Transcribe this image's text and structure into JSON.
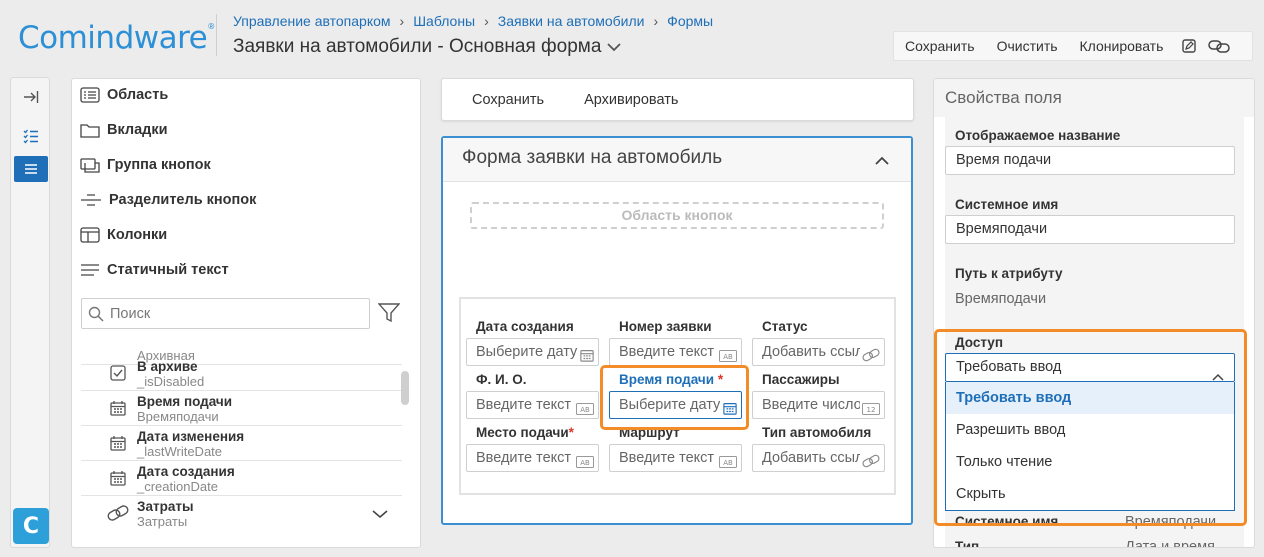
{
  "header": {
    "logo": "Comindware",
    "logo_mark": "®",
    "breadcrumbs": [
      "Управление автопарком",
      "Шаблоны",
      "Заявки на автомобили",
      "Формы"
    ],
    "breadcrumb_sep": "›",
    "title": "Заявки на автомобили - Основная форма",
    "toolbar": {
      "save": "Сохранить",
      "clear": "Очистить",
      "clone": "Клонировать"
    }
  },
  "rail": {
    "logo_letter": "C"
  },
  "components": {
    "items": [
      "Область",
      "Вкладки",
      "Группа кнопок",
      "Разделитель кнопок",
      "Колонки",
      "Статичный текст"
    ],
    "search_placeholder": "Поиск",
    "partial_row": "Архивная",
    "attributes": [
      {
        "name": "В архиве",
        "sys": "_isDisabled",
        "icon": "checkbox-icon"
      },
      {
        "name": "Время подачи",
        "sys": "Времяподачи",
        "icon": "calendar-icon"
      },
      {
        "name": "Дата изменения",
        "sys": "_lastWriteDate",
        "icon": "calendar-icon"
      },
      {
        "name": "Дата создания",
        "sys": "_creationDate",
        "icon": "calendar-icon"
      },
      {
        "name": "Затраты",
        "sys": "Затраты",
        "icon": "link-icon"
      }
    ]
  },
  "form": {
    "toolbar": {
      "save": "Сохранить",
      "archive": "Архивировать"
    },
    "title": "Форма заявки на автомобиль",
    "button_area": "Область кнопок",
    "fields": [
      {
        "label": "Дата создания",
        "placeholder": "Выберите дату",
        "icon": "calendar-icon",
        "required": false
      },
      {
        "label": "Номер заявки",
        "placeholder": "Введите текст",
        "icon": "text-icon",
        "required": false
      },
      {
        "label": "Статус",
        "placeholder": "Добавить ссылку",
        "icon": "link-icon",
        "required": false
      },
      {
        "label": "Ф. И. О.",
        "placeholder": "Введите текст",
        "icon": "text-icon",
        "required": false
      },
      {
        "label": "Время подачи",
        "placeholder": "Выберите дату",
        "icon": "calendar-icon",
        "required": true,
        "selected": true
      },
      {
        "label": "Пассажиры",
        "placeholder": "Введите число",
        "icon": "number-icon",
        "required": false
      },
      {
        "label": "Место подачи",
        "placeholder": "Введите текст",
        "icon": "text-icon",
        "required": true
      },
      {
        "label": "Маршрут",
        "placeholder": "Введите текст",
        "icon": "text-icon",
        "required": false
      },
      {
        "label": "Тип автомобиля",
        "placeholder": "Добавить ссылку",
        "icon": "link-icon",
        "required": false
      }
    ],
    "required_mark": "*"
  },
  "properties": {
    "title": "Свойства поля",
    "display_name_label": "Отображаемое название",
    "display_name_value": "Время подачи",
    "system_name_label": "Системное имя",
    "system_name_value": "Времяподачи",
    "path_label": "Путь к атрибуту",
    "path_value": "Времяподачи",
    "access_label": "Доступ",
    "access_value": "Требовать ввод",
    "access_options": [
      "Требовать ввод",
      "Разрешить ввод",
      "Только чтение",
      "Скрыть"
    ],
    "bottom_rows": [
      {
        "label": "Системное имя",
        "value": "Времяподачи"
      },
      {
        "label": "Тип",
        "value": "Дата и время"
      }
    ]
  },
  "colors": {
    "accent": "#1e6fb8",
    "highlight": "#f28c28",
    "required": "#d9342b"
  }
}
